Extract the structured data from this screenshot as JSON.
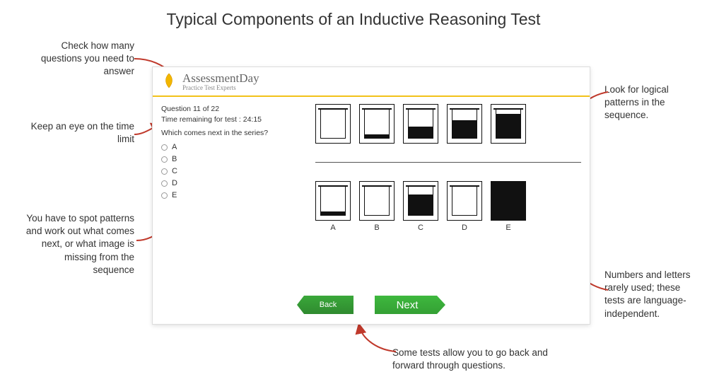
{
  "page_title": "Typical Components of an Inductive Reasoning Test",
  "logo": {
    "main": "AssessmentDay",
    "sub": "Practice Test Experts"
  },
  "question": {
    "counter": "Question 11 of 22",
    "time": "Time remaining for test : 24:15",
    "prompt": "Which comes next in the series?",
    "options": [
      "A",
      "B",
      "C",
      "D",
      "E"
    ],
    "answer_labels": [
      "A",
      "B",
      "C",
      "D",
      "E"
    ]
  },
  "nav": {
    "back": "Back",
    "next": "Next"
  },
  "annotations": {
    "check_questions": "Check how many questions you need to answer",
    "time_limit": "Keep an eye on the time limit",
    "spot_patterns": "You have to spot patterns and work out what comes next, or what image is missing from the sequence",
    "logical_patterns": "Look for logical patterns in the sequence.",
    "language_independent": "Numbers and letters rarely used; these tests are language-independent.",
    "back_forward": "Some tests allow you to go back and forward through questions."
  },
  "colors": {
    "accent_yellow": "#f2c21a",
    "button_green": "#3aa83a",
    "arrow_red": "#c0392b"
  }
}
